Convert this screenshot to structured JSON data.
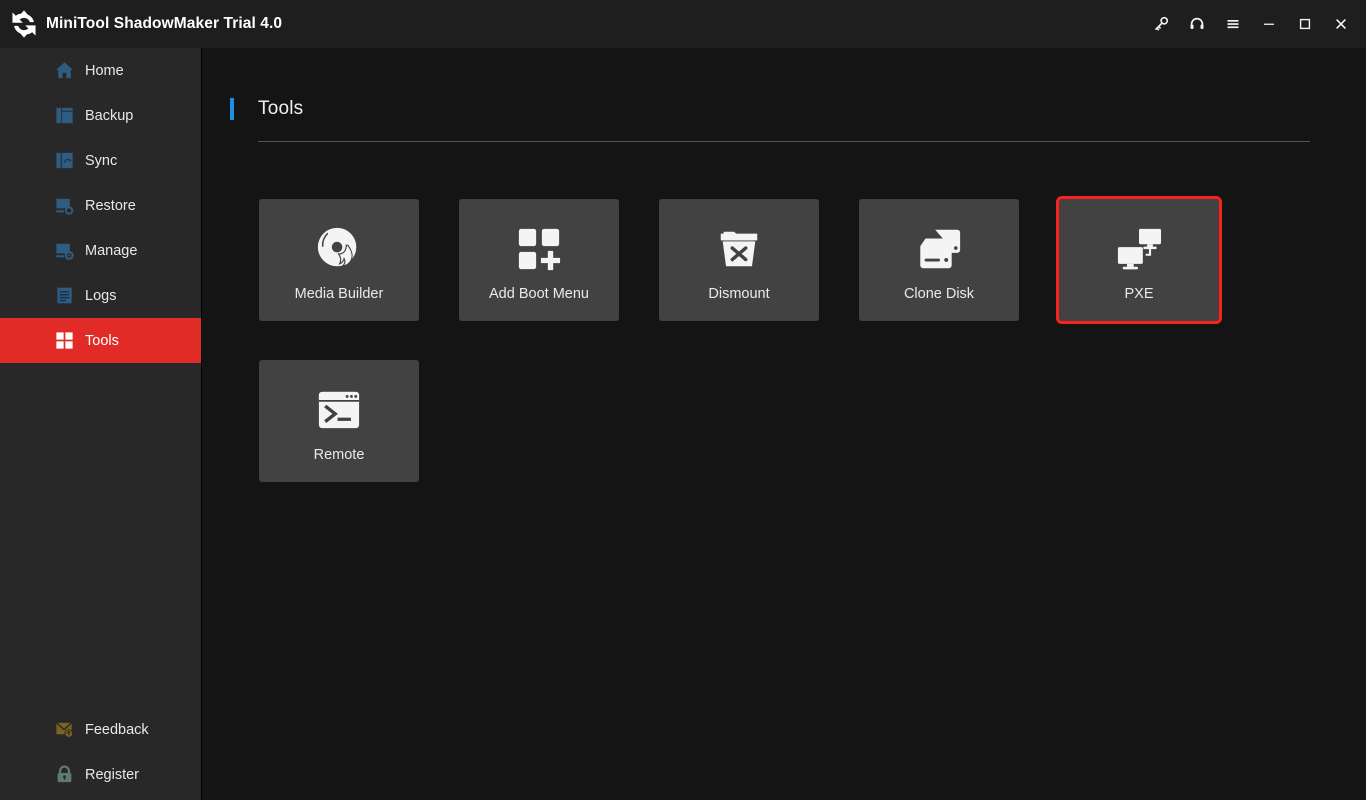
{
  "window": {
    "title": "MiniTool ShadowMaker Trial 4.0",
    "logo_icon": "sync-arrows-logo",
    "controls": [
      {
        "name": "key-icon",
        "label": "⚔"
      },
      {
        "name": "headset-icon",
        "label": "⌂"
      },
      {
        "name": "menu-icon",
        "label": "≡"
      },
      {
        "name": "minimize-icon",
        "label": "─"
      },
      {
        "name": "maximize-icon",
        "label": "□"
      },
      {
        "name": "close-icon",
        "label": "✕"
      }
    ]
  },
  "sidebar": {
    "background": "#282828",
    "active_color": "#e02b27",
    "items": [
      {
        "label": "Home",
        "icon": "home-icon",
        "active": false
      },
      {
        "label": "Backup",
        "icon": "backup-icon",
        "active": false
      },
      {
        "label": "Sync",
        "icon": "sync-icon",
        "active": false
      },
      {
        "label": "Restore",
        "icon": "restore-icon",
        "active": false
      },
      {
        "label": "Manage",
        "icon": "manage-icon",
        "active": false
      },
      {
        "label": "Logs",
        "icon": "logs-icon",
        "active": false
      },
      {
        "label": "Tools",
        "icon": "tools-icon",
        "active": true
      }
    ],
    "bottom_items": [
      {
        "label": "Feedback",
        "icon": "feedback-envelope-icon"
      },
      {
        "label": "Register",
        "icon": "lock-icon"
      }
    ]
  },
  "main": {
    "title": "Tools",
    "accent_color": "#1e8fe1",
    "tiles": [
      {
        "label": "Media Builder",
        "icon": "disc-flame-icon",
        "highlighted": false
      },
      {
        "label": "Add Boot Menu",
        "icon": "squares-plus-icon",
        "highlighted": false
      },
      {
        "label": "Dismount",
        "icon": "container-x-icon",
        "highlighted": false
      },
      {
        "label": "Clone Disk",
        "icon": "disk-clone-icon",
        "highlighted": false
      },
      {
        "label": "PXE",
        "icon": "two-monitors-icon",
        "highlighted": true
      },
      {
        "label": "Remote",
        "icon": "terminal-window-icon",
        "highlighted": false
      }
    ],
    "highlight_color": "#f8231b"
  }
}
